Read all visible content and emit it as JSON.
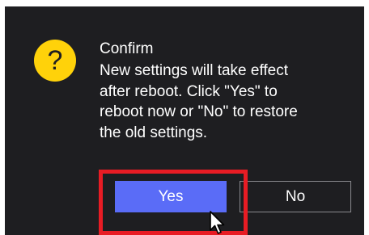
{
  "dialog": {
    "title": "Confirm",
    "message": "New settings will take effect\nafter reboot. Click \"Yes\" to\nreboot now or \"No\" to restore\nthe old settings.",
    "icon": "question-icon",
    "icon_glyph": "?",
    "icon_color": "#ffd20a",
    "background_color": "#1e1e21"
  },
  "buttons": {
    "yes_label": "Yes",
    "no_label": "No",
    "yes_color": "#5a6cf7"
  },
  "annotation": {
    "highlight_color": "#e81c24",
    "highlight_target": "yes-button"
  }
}
